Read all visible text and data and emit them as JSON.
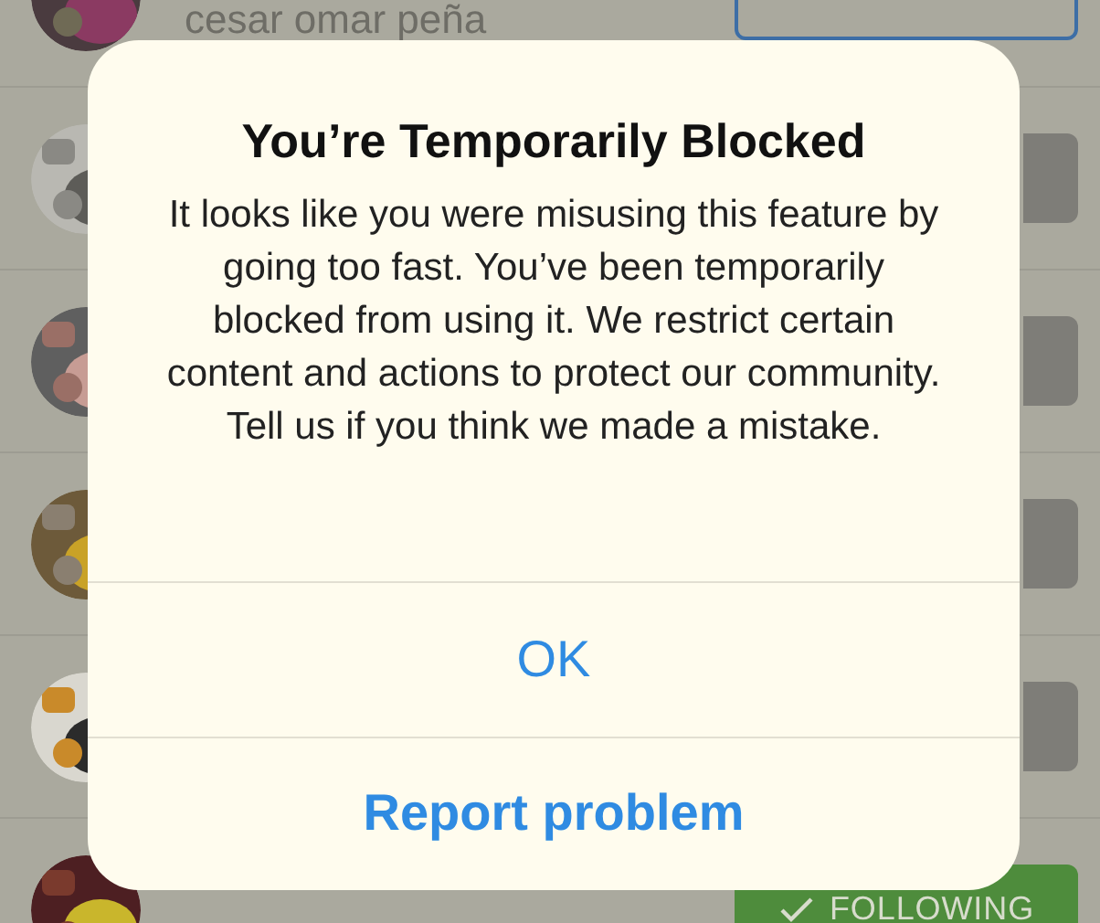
{
  "background_list": {
    "rows": [
      {
        "name": "cesar omar peña",
        "button": {
          "kind": "outline"
        }
      },
      {
        "button": {
          "kind": "gray"
        }
      },
      {
        "button": {
          "kind": "gray"
        }
      },
      {
        "button": {
          "kind": "gray"
        }
      },
      {
        "button": {
          "kind": "gray"
        }
      },
      {
        "button": {
          "kind": "following",
          "label": "FOLLOWING"
        }
      }
    ]
  },
  "dialog": {
    "title": "You’re Temporarily Blocked",
    "message": "It looks like you were misusing this feature by going too fast. You’ve been temporarily blocked from using it. We restrict certain content and actions to protect our community. Tell us if you think we made a mistake.",
    "buttons": [
      {
        "label": "OK",
        "kind": "plain"
      },
      {
        "label": "Report problem",
        "kind": "bold"
      }
    ]
  }
}
